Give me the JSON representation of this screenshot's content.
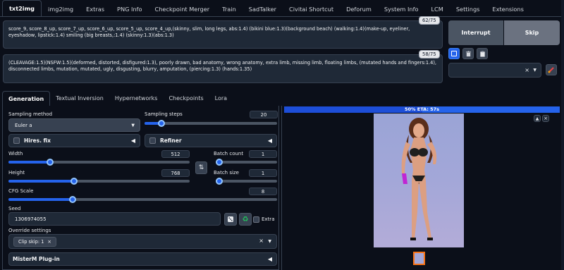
{
  "tabs": [
    "txt2img",
    "img2img",
    "Extras",
    "PNG Info",
    "Checkpoint Merger",
    "Train",
    "SadTalker",
    "Civitai Shortcut",
    "Deforum",
    "System Info",
    "LCM",
    "Settings",
    "Extensions"
  ],
  "active_tab": "txt2img",
  "prompt": {
    "text": "score_9, score_8_up, score_7_up, score_6_up, score_5_up, score_4_up,(skinny, slim, long legs, abs:1.4) (bikini blue:1.3)(background beach) (walking:1.4)(make-up, eyeliner, eyeshadow, lipstick:1.4) smiling (big breasts,:1.4) (skinny:1.3)(abs:1.3)",
    "counter": "62/75"
  },
  "negative_prompt": {
    "text": "(CLEAVAGE:1.5)(NSFW:1.5)(deformed, distorted, disfigured:1.3), poorly drawn, bad anatomy, wrong anatomy, extra limb, missing limb, floating limbs, (mutated hands and fingers:1.4), disconnected limbs, mutation, mutated, ugly, disgusting, blurry, amputation, (piercing:1.3) (hands:1.35)",
    "counter": "58/75"
  },
  "buttons": {
    "interrupt": "Interrupt",
    "skip": "Skip"
  },
  "subtabs": [
    "Generation",
    "Textual Inversion",
    "Hypernetworks",
    "Checkpoints",
    "Lora"
  ],
  "active_subtab": "Generation",
  "sampling": {
    "method_label": "Sampling method",
    "method_value": "Euler a",
    "steps_label": "Sampling steps",
    "steps_value": "20",
    "steps_fraction": 0.13
  },
  "hires_fix": {
    "label": "Hires. fix",
    "checked": false
  },
  "refiner": {
    "label": "Refiner",
    "checked": false
  },
  "width": {
    "label": "Width",
    "value": "512",
    "fraction": 0.23
  },
  "height": {
    "label": "Height",
    "value": "768",
    "fraction": 0.36
  },
  "batch_count": {
    "label": "Batch count",
    "value": "1",
    "fraction": 0.0
  },
  "batch_size": {
    "label": "Batch size",
    "value": "1",
    "fraction": 0.0
  },
  "cfg": {
    "label": "CFG Scale",
    "value": "8",
    "fraction": 0.24
  },
  "seed": {
    "label": "Seed",
    "value": "1306974055",
    "extra_label": "Extra"
  },
  "override": {
    "label": "Override settings",
    "chip": "Clip skip: 1"
  },
  "plugin": {
    "label": "MisterM Plug-in"
  },
  "progress": {
    "text": "50% ETA: 57s",
    "fraction": 0.5
  },
  "colors": {
    "accent": "#2563eb",
    "background": "#0b0f19",
    "panel": "#1f2937"
  },
  "icons": {
    "swap": "swap-icon",
    "dice": "dice-icon",
    "recycle": "recycle-icon",
    "trash": "trash-icon",
    "clipboard": "clipboard-icon",
    "brush": "paintbrush-icon"
  }
}
